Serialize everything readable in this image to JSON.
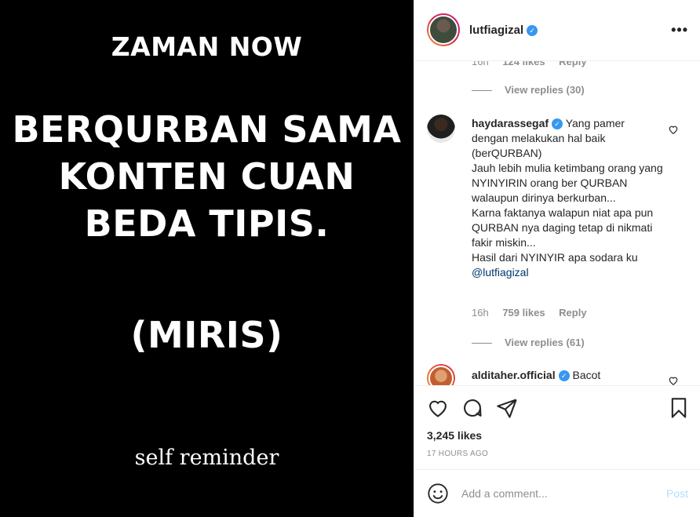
{
  "image": {
    "line1": "ZAMAN NOW",
    "line2": [
      "BERQURBAN SAMA",
      "KONTEN CUAN",
      "BEDA TIPIS."
    ],
    "line3": "(MIRIS)",
    "line4": "self reminder"
  },
  "header": {
    "username": "lutfiagizal",
    "more_icon": "more-horizontal-icon"
  },
  "comments": {
    "prev_meta": {
      "time": "16h",
      "likes": "124 likes",
      "reply": "Reply"
    },
    "prev_view_replies": "View replies (30)",
    "items": [
      {
        "username": "haydarassegaf",
        "text": "Yang pamer dengan melakukan hal baik (berQURBAN)\nJauh lebih mulia ketimbang orang yang NYINYIRIN orang ber QURBAN walaupun dirinya berkurban...\nKarna faktanya walapun niat apa pun QURBAN nya daging tetap di nikmati fakir miskin...\nHasil dari NYINYIR apa sodara ku",
        "mention": "@lutfiagizal",
        "time": "16h",
        "likes": "759 likes",
        "reply": "Reply",
        "view_replies": "View replies (61)"
      },
      {
        "username": "alditaher.official",
        "text": "Bacot"
      }
    ]
  },
  "actions": {
    "likes": "3,245 likes",
    "time": "17 HOURS AGO"
  },
  "add_comment": {
    "placeholder": "Add a comment...",
    "post_label": "Post"
  },
  "colors": {
    "verified": "#3897f0",
    "link": "#00376b",
    "post_disabled": "#b2dffc"
  }
}
